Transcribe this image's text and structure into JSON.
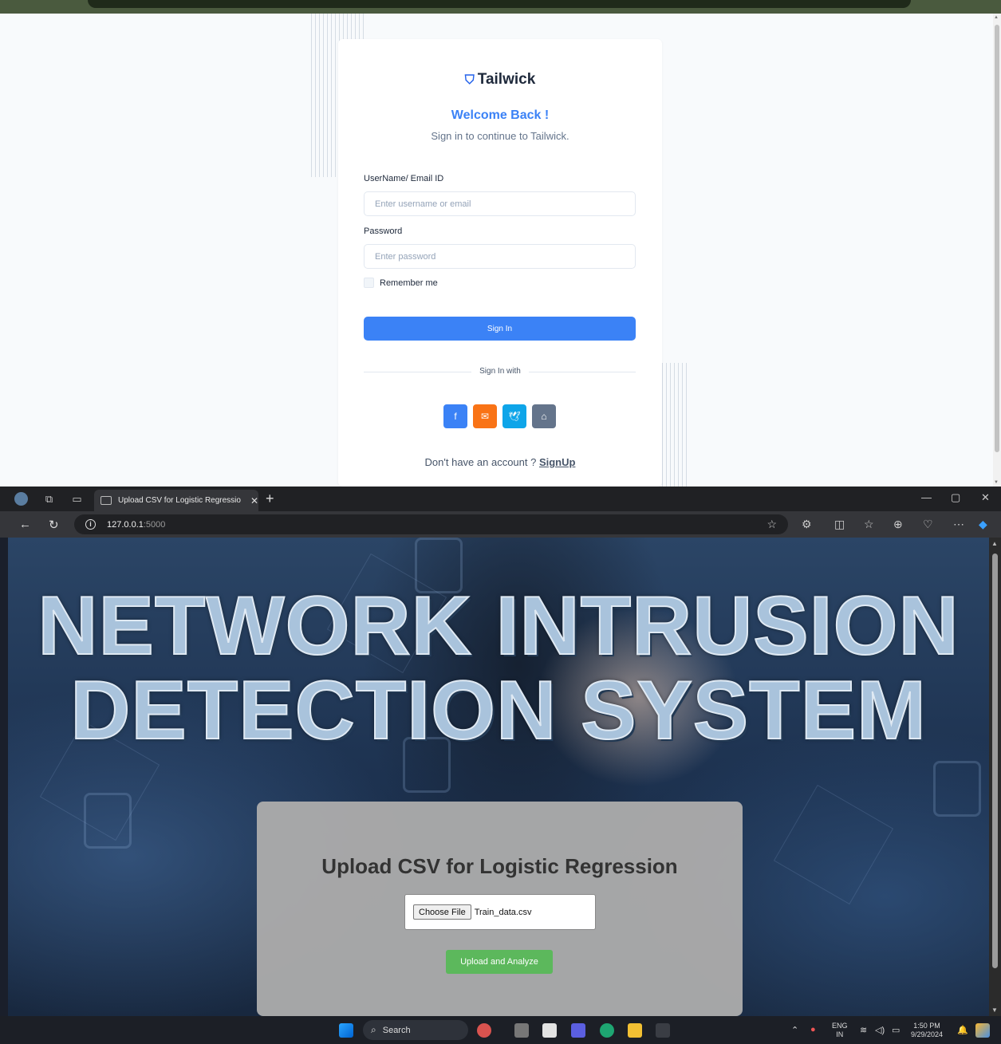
{
  "login": {
    "brand": "Tailwick",
    "welcome": "Welcome Back !",
    "subtitle": "Sign in to continue to Tailwick.",
    "username_label": "UserName/ Email ID",
    "username_placeholder": "Enter username or email",
    "password_label": "Password",
    "password_placeholder": "Enter password",
    "remember_label": "Remember me",
    "signin_button": "Sign In",
    "signin_with": "Sign In with",
    "social": [
      {
        "name": "facebook",
        "color": "#3b82f6"
      },
      {
        "name": "email",
        "color": "#f97316"
      },
      {
        "name": "twitter",
        "color": "#0ea5e9"
      },
      {
        "name": "github",
        "color": "#64748b"
      }
    ],
    "no_account": "Don't have an account ? ",
    "signup_link": "SignUp"
  },
  "browser": {
    "tab_title": "Upload CSV for Logistic Regressio",
    "url_host": "127.0.0.1",
    "url_port": ":5000"
  },
  "page": {
    "hero_line1": "NETWORK INTRUSION",
    "hero_line2": "DETECTION SYSTEM",
    "heading": "Upload CSV for Logistic Regression",
    "choose_file_label": "Choose File",
    "file_name": "Train_data.csv",
    "upload_button": "Upload and Analyze"
  },
  "taskbar": {
    "search_label": "Search",
    "lang_top": "ENG",
    "lang_bottom": "IN",
    "time": "1:50 PM",
    "date": "9/29/2024"
  },
  "colors": {
    "primary_blue": "#3b82f6",
    "upload_green": "#5cb85c",
    "panel_gray": "#aaaaaa"
  }
}
